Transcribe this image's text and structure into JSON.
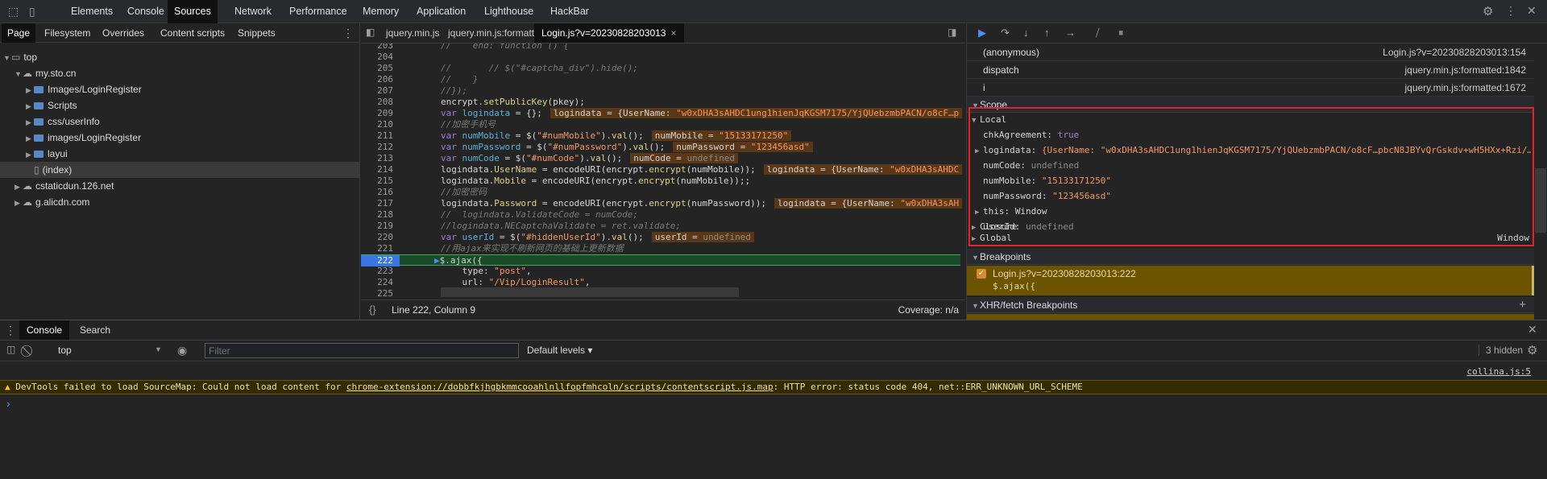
{
  "topbar": {
    "tabs": [
      "Elements",
      "Console",
      "Sources",
      "Network",
      "Performance",
      "Memory",
      "Application",
      "Lighthouse",
      "HackBar"
    ],
    "selected": "Sources"
  },
  "navigator": {
    "tabs": [
      "Page",
      "Filesystem",
      "Overrides",
      "Content scripts",
      "Snippets"
    ],
    "tree": [
      "top",
      "my.sto.cn",
      "Images/LoginRegister",
      "Scripts",
      "css/userInfo",
      "images/LoginRegister",
      "layui",
      "(index)",
      "cstaticdun.126.net",
      "g.alicdn.com"
    ]
  },
  "editor": {
    "tabs": [
      "jquery.min.js",
      "jquery.min.js:formatted",
      "Login.js?v=20230828203013"
    ],
    "lines": [
      {
        "n": "203",
        "t": [
          [
            "c",
            "//    end: function () {"
          ]
        ]
      },
      {
        "n": "204",
        "t": []
      },
      {
        "n": "205",
        "t": [
          [
            "c",
            "//       // $(\"#captcha_div\").hide();"
          ]
        ]
      },
      {
        "n": "206",
        "t": [
          [
            "c",
            "//    }"
          ]
        ]
      },
      {
        "n": "207",
        "t": [
          [
            "c",
            "//});"
          ]
        ]
      },
      {
        "n": "208",
        "t": [
          [
            "p",
            "encrypt."
          ],
          [
            "m",
            "setPublicKey"
          ],
          [
            "p",
            "(pkey);"
          ]
        ]
      },
      {
        "n": "209",
        "t": [
          [
            "k",
            "var "
          ],
          [
            "v",
            "logindata"
          ],
          [
            "p",
            " = {};"
          ]
        ],
        "b": [
          [
            "p",
            "logindata = {UserName: "
          ],
          [
            "s",
            "\"w0xDHA3sAHDC1ung1hienJqKGSM7175/YjQUebzmbPACN/o8cF…p"
          ]
        ]
      },
      {
        "n": "210",
        "t": [
          [
            "c",
            "//加密手机号"
          ]
        ]
      },
      {
        "n": "211",
        "t": [
          [
            "k",
            "var "
          ],
          [
            "v",
            "numMobile"
          ],
          [
            "p",
            " = $("
          ],
          [
            "s",
            "\"#numMobile\""
          ],
          [
            "p",
            ")."
          ],
          [
            "m",
            "val"
          ],
          [
            "p",
            "();"
          ]
        ],
        "b": [
          [
            "p",
            "numMobile = "
          ],
          [
            "s",
            "\"15133171250\""
          ]
        ]
      },
      {
        "n": "212",
        "t": [
          [
            "k",
            "var "
          ],
          [
            "v",
            "numPassword"
          ],
          [
            "p",
            " = $("
          ],
          [
            "s",
            "\"#numPassword\""
          ],
          [
            "p",
            ")."
          ],
          [
            "m",
            "val"
          ],
          [
            "p",
            "();"
          ]
        ],
        "b": [
          [
            "p",
            "numPassword = "
          ],
          [
            "s",
            "\"123456asd\""
          ]
        ]
      },
      {
        "n": "213",
        "t": [
          [
            "k",
            "var "
          ],
          [
            "v",
            "numCode"
          ],
          [
            "p",
            " = $("
          ],
          [
            "s",
            "\"#numCode\""
          ],
          [
            "p",
            ")."
          ],
          [
            "m",
            "val"
          ],
          [
            "p",
            "();"
          ]
        ],
        "b": [
          [
            "p",
            "numCode = "
          ],
          [
            "u",
            "undefined"
          ]
        ]
      },
      {
        "n": "214",
        "t": [
          [
            "p",
            "logindata."
          ],
          [
            "m",
            "UserName"
          ],
          [
            "p",
            " = encodeURI(encrypt."
          ],
          [
            "m",
            "encrypt"
          ],
          [
            "p",
            "(numMobile));"
          ]
        ],
        "b": [
          [
            "p",
            "logindata = {UserName: "
          ],
          [
            "s",
            "\"w0xDHA3sAHDC"
          ]
        ]
      },
      {
        "n": "215",
        "t": [
          [
            "p",
            "logindata."
          ],
          [
            "m",
            "Mobile"
          ],
          [
            "p",
            " = encodeURI(encrypt."
          ],
          [
            "m",
            "encrypt"
          ],
          [
            "p",
            "(numMobile));;"
          ]
        ]
      },
      {
        "n": "216",
        "t": [
          [
            "c",
            "//加密密码"
          ]
        ]
      },
      {
        "n": "217",
        "t": [
          [
            "p",
            "logindata."
          ],
          [
            "m",
            "Password"
          ],
          [
            "p",
            " = encodeURI(encrypt."
          ],
          [
            "m",
            "encrypt"
          ],
          [
            "p",
            "(numPassword));"
          ]
        ],
        "b": [
          [
            "p",
            "logindata = {UserName: "
          ],
          [
            "s",
            "\"w0xDHA3sAH"
          ]
        ]
      },
      {
        "n": "218",
        "t": [
          [
            "c",
            "//  logindata.ValidateCode = numCode;"
          ]
        ]
      },
      {
        "n": "219",
        "t": [
          [
            "c",
            "//logindata.NECaptchaValidate = ret.validate;"
          ]
        ]
      },
      {
        "n": "220",
        "t": [
          [
            "k",
            "var "
          ],
          [
            "v",
            "userId"
          ],
          [
            "p",
            " = $("
          ],
          [
            "s",
            "\"#hiddenUserId\""
          ],
          [
            "p",
            ")."
          ],
          [
            "m",
            "val"
          ],
          [
            "p",
            "();"
          ]
        ],
        "b": [
          [
            "p",
            "userId = "
          ],
          [
            "u",
            "undefined"
          ]
        ]
      },
      {
        "n": "221",
        "t": [
          [
            "c",
            "//用ajax来实现不刷新网页的基础上更新数据"
          ]
        ]
      },
      {
        "n": "222",
        "t": [
          [
            "p",
            "$."
          ],
          [
            "p",
            "ajax({"
          ]
        ],
        "exec": true
      },
      {
        "n": "223",
        "t": [
          [
            "p",
            "    type: "
          ],
          [
            "s",
            "\"post\""
          ],
          [
            "p",
            ","
          ]
        ]
      },
      {
        "n": "224",
        "t": [
          [
            "p",
            "    url: "
          ],
          [
            "s",
            "\"/Vip/LoginResult\""
          ],
          [
            "p",
            ","
          ]
        ]
      },
      {
        "n": "225",
        "t": []
      }
    ],
    "status": {
      "position": "Line 222, Column 9",
      "coverage": "Coverage: n/a"
    }
  },
  "debugger": {
    "callstack": [
      {
        "fn": "(anonymous)",
        "loc": "Login.js?v=20230828203013:154"
      },
      {
        "fn": "dispatch",
        "loc": "jquery.min.js:formatted:1842"
      },
      {
        "fn": "i",
        "loc": "jquery.min.js:formatted:1672"
      }
    ],
    "scope_label": "Scope",
    "local_label": "Local",
    "local": [
      {
        "key": "chkAgreement",
        "val": "true",
        "cls": "k",
        "exp": false
      },
      {
        "key": "logindata",
        "val": "{UserName: \"w0xDHA3sAHDC1ung1hienJqKGSM7175/YjQUebzmbPACN/o8cF…pbcN8JBYvQrGskdv+wH5HXx+Rzi/…",
        "cls": "s",
        "exp": true
      },
      {
        "key": "numCode",
        "val": "undefined",
        "cls": "u",
        "exp": false
      },
      {
        "key": "numMobile",
        "val": "\"15133171250\"",
        "cls": "s",
        "exp": false
      },
      {
        "key": "numPassword",
        "val": "\"123456asd\"",
        "cls": "s",
        "exp": false
      },
      {
        "key": "this",
        "val": "Window",
        "cls": "p",
        "exp": true
      },
      {
        "key": "userId",
        "val": "undefined",
        "cls": "u",
        "exp": false
      }
    ],
    "closure_label": "Closure",
    "global_label": "Global",
    "global_value": "Window",
    "breakpoints_label": "Breakpoints",
    "breakpoint": {
      "file": "Login.js?v=20230828203013:222",
      "code": "$.ajax({",
      "checked": true
    },
    "xhr_label": "XHR/fetch Breakpoints"
  },
  "drawer": {
    "tabs": [
      "Console",
      "Search"
    ],
    "context": "top",
    "filter_placeholder": "Filter",
    "levels": "Default levels ▾",
    "hidden": "3 hidden",
    "source_link": "collina.js:5",
    "warning": {
      "pre": "DevTools failed to load SourceMap: Could not load content for ",
      "link": "chrome-extension://dobbfkjhgbkmmcooahlnllfopfmhcoln/scripts/contentscript.js.map",
      "post": ": HTTP error: status code 404, net::ERR_UNKNOWN_URL_SCHEME"
    },
    "prompt": "›"
  },
  "colors": {
    "accent": "#3b76e8",
    "exec_line": "#1c4a2a",
    "highlight_box": "#e0262b",
    "warning_bg": "#332a00",
    "breakpoint_bg": "#6b5300"
  }
}
